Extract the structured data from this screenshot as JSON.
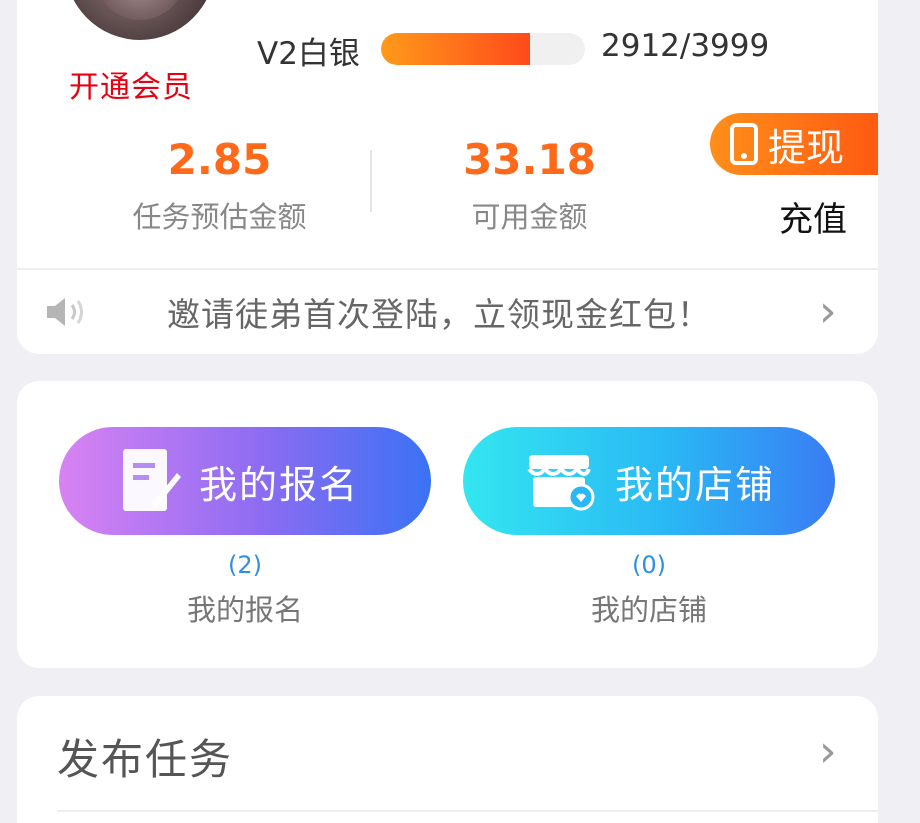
{
  "member": {
    "open_vip_label": "开通会员"
  },
  "level": {
    "label": "V2白银",
    "progress_text": "2912/3999",
    "progress_fraction": 0.728,
    "fill_color": "#ff5a1a"
  },
  "stats": [
    {
      "value": "2.85",
      "label": "任务预估金额"
    },
    {
      "value": "33.18",
      "label": "可用金额"
    }
  ],
  "actions": {
    "withdraw_label": "提现",
    "recharge_label": "充值"
  },
  "notice": {
    "text": "邀请徒弟首次登陆，立领现金红包！",
    "chevron": "›"
  },
  "features": [
    {
      "button_label": "我的报名",
      "count": "(2)",
      "label": "我的报名"
    },
    {
      "button_label": "我的店铺",
      "count": "(0)",
      "label": "我的店铺"
    }
  ],
  "publish": {
    "label": "发布任务",
    "chevron": "›"
  },
  "colors": {
    "accent": "#ff6a1a",
    "vip_red": "#e60012",
    "count_blue": "#2e8fe6"
  },
  "icons": [
    "phone-icon",
    "speaker-icon",
    "chevron-right-icon",
    "signup-form-icon",
    "shop-icon"
  ]
}
